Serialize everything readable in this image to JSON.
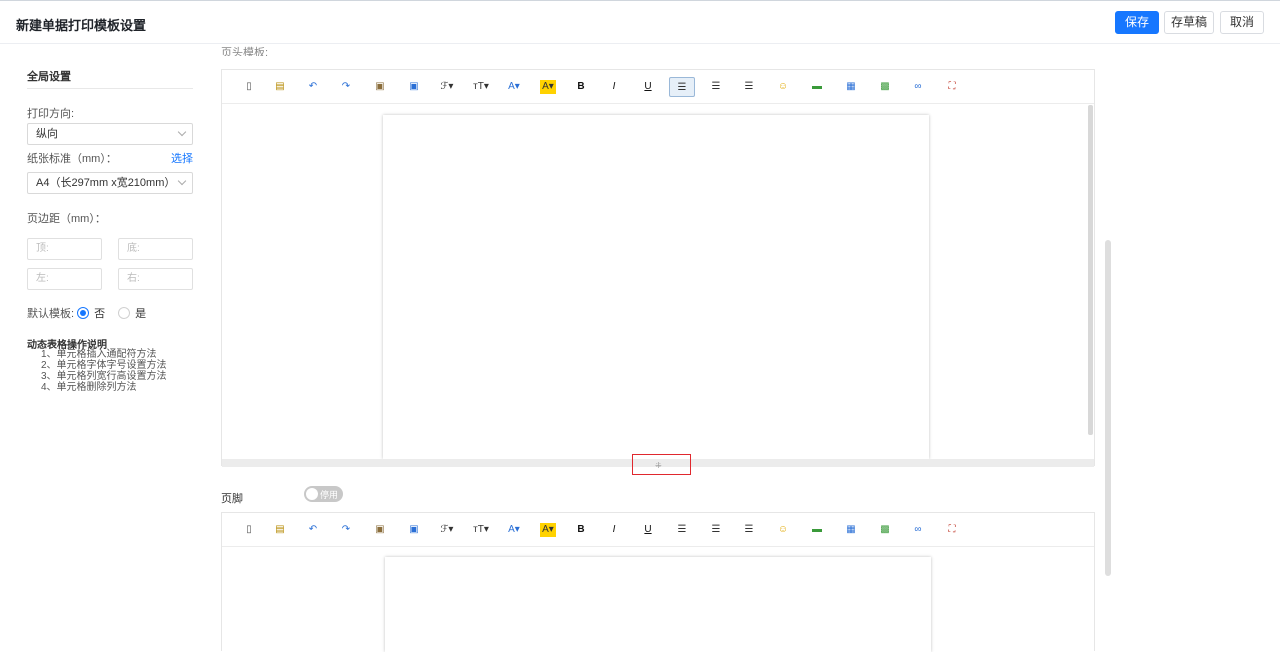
{
  "header": {
    "title": "新建单据打印模板设置",
    "save": "保存",
    "draft": "存草稿",
    "cancel": "取消"
  },
  "left": {
    "section_title": "全局设置",
    "orientation_label": "打印方向:",
    "orientation_value": "纵向",
    "paper_label": "纸张标准（mm）：",
    "paper_select_link": "选择",
    "paper_value": "A4（长297mm x宽210mm）",
    "margin_label": "页边距（mm）：",
    "margin_top": "顶:",
    "margin_bottom": "底:",
    "margin_left": "左:",
    "margin_right": "右:",
    "default_label": "默认模板:",
    "default_no": "否",
    "default_yes": "是",
    "help_title": "动态表格操作说明",
    "help_items": [
      "1、单元格插入通配符方法",
      "2、单元格字体字号设置方法",
      "3、单元格列宽行高设置方法",
      "4、单元格删除列方法"
    ]
  },
  "header_section_cut": "页头模板:",
  "footer": {
    "label": "页脚",
    "toggle_text": "停用"
  },
  "toolbar_icons": [
    "source",
    "template",
    "undo",
    "redo",
    "paste",
    "paste-text",
    "font",
    "font-size",
    "font-color",
    "bg-color",
    "bold",
    "italic",
    "underline",
    "align-left",
    "align-center",
    "align-right",
    "emoji",
    "insert-row",
    "table",
    "image",
    "link",
    "fullscreen"
  ],
  "colors": {
    "primary": "#1677ff",
    "highlight_box": "#e0282e"
  }
}
